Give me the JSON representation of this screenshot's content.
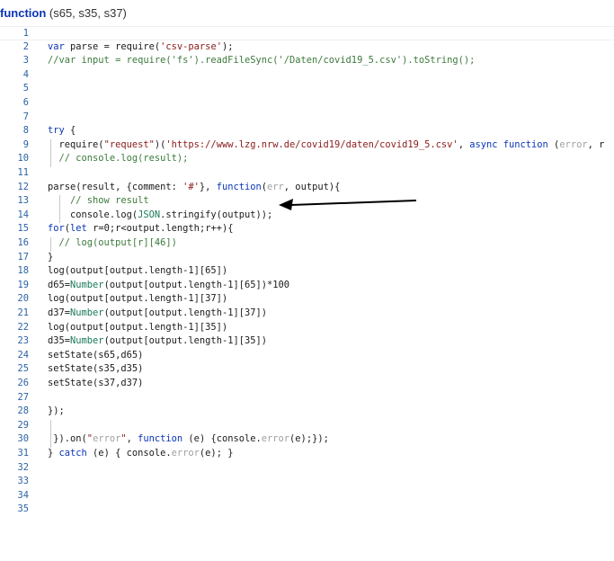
{
  "header": {
    "keyword": "function",
    "params": "(s65, s35, s37)"
  },
  "colors": {
    "keyword": "#0a35b6",
    "string": "#8a1a1a",
    "comment": "#3b7a3b",
    "line_number": "#2b63a6"
  },
  "lines": [
    {
      "n": "1",
      "text": ""
    },
    {
      "n": "2",
      "text": "var parse = require('csv-parse');"
    },
    {
      "n": "3",
      "text": "//var input = require('fs').readFileSync('/Daten/covid19_5.csv').toString();"
    },
    {
      "n": "4",
      "text": ""
    },
    {
      "n": "5",
      "text": ""
    },
    {
      "n": "6",
      "text": ""
    },
    {
      "n": "7",
      "text": ""
    },
    {
      "n": "8",
      "text": "try {"
    },
    {
      "n": "9",
      "text": "  require(\"request\")('https://www.lzg.nrw.de/covid19/daten/covid19_5.csv', async function (error, r"
    },
    {
      "n": "10",
      "text": "  // console.log(result);"
    },
    {
      "n": "11",
      "text": ""
    },
    {
      "n": "12",
      "text": "parse(result, {comment: '#'}, function(err, output){"
    },
    {
      "n": "13",
      "text": "    // show result"
    },
    {
      "n": "14",
      "text": "    console.log(JSON.stringify(output));"
    },
    {
      "n": "15",
      "text": "for(let r=0;r<output.length;r++){"
    },
    {
      "n": "16",
      "text": "  // log(output[r][46])"
    },
    {
      "n": "17",
      "text": "}"
    },
    {
      "n": "18",
      "text": "log(output[output.length-1][65])"
    },
    {
      "n": "19",
      "text": "d65=Number(output[output.length-1][65])*100"
    },
    {
      "n": "20",
      "text": "log(output[output.length-1][37])"
    },
    {
      "n": "21",
      "text": "d37=Number(output[output.length-1][37])"
    },
    {
      "n": "22",
      "text": "log(output[output.length-1][35])"
    },
    {
      "n": "23",
      "text": "d35=Number(output[output.length-1][35])"
    },
    {
      "n": "24",
      "text": "setState(s65,d65)"
    },
    {
      "n": "25",
      "text": "setState(s35,d35)"
    },
    {
      "n": "26",
      "text": "setState(s37,d37)"
    },
    {
      "n": "27",
      "text": ""
    },
    {
      "n": "28",
      "text": "});"
    },
    {
      "n": "29",
      "text": ""
    },
    {
      "n": "30",
      "text": " }).on(\"error\", function (e) {console.error(e);});"
    },
    {
      "n": "31",
      "text": "} catch (e) { console.error(e); }"
    },
    {
      "n": "32",
      "text": ""
    },
    {
      "n": "33",
      "text": ""
    },
    {
      "n": "34",
      "text": ""
    },
    {
      "n": "35",
      "text": ""
    }
  ]
}
